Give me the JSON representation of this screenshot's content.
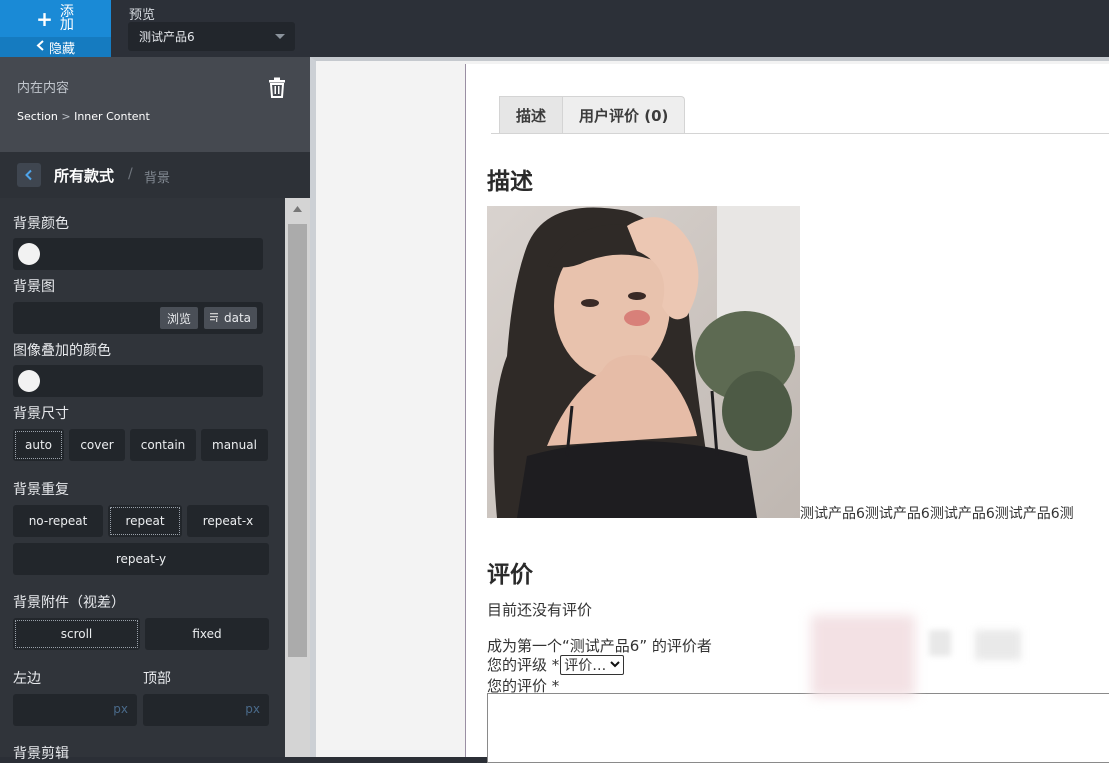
{
  "toolbar": {
    "add_label": "添加",
    "hide_label": "隐藏",
    "preview_label": "预览",
    "selected_product": "测试产品6"
  },
  "panel": {
    "title": "内在内容",
    "breadcrumb": {
      "section": "Section",
      "separator": " > ",
      "current": "Inner Content"
    },
    "nav": {
      "title": "所有款式",
      "separator": "/",
      "sub": "背景"
    }
  },
  "bg": {
    "color_label": "背景颜色",
    "image_label": "背景图",
    "browse_label": "浏览",
    "data_label": "data",
    "overlay_label": "图像叠加的颜色",
    "size_label": "背景尺寸",
    "size_options": [
      "auto",
      "cover",
      "contain",
      "manual"
    ],
    "size_selected": "auto",
    "repeat_label": "背景重复",
    "repeat_options": [
      "no-repeat",
      "repeat",
      "repeat-x",
      "repeat-y"
    ],
    "repeat_selected": "repeat",
    "attach_label": "背景附件（视差）",
    "attach_options": [
      "scroll",
      "fixed"
    ],
    "attach_selected": "scroll",
    "left_label": "左边",
    "top_label": "顶部",
    "unit": "px",
    "crop_label": "背景剪辑"
  },
  "page": {
    "tabs": [
      "描述",
      "用户评价 (0)"
    ],
    "desc_heading": "描述",
    "product_text": "测试产品6测试产品6测试产品6测试产品6测",
    "review_heading": "评价",
    "no_reviews": "目前还没有评价",
    "first_review": "成为第一个“测试产品6” 的评价者",
    "rating_label": "您的评级 *",
    "rating_select": "评价…",
    "review_label": "您的评价 *"
  }
}
